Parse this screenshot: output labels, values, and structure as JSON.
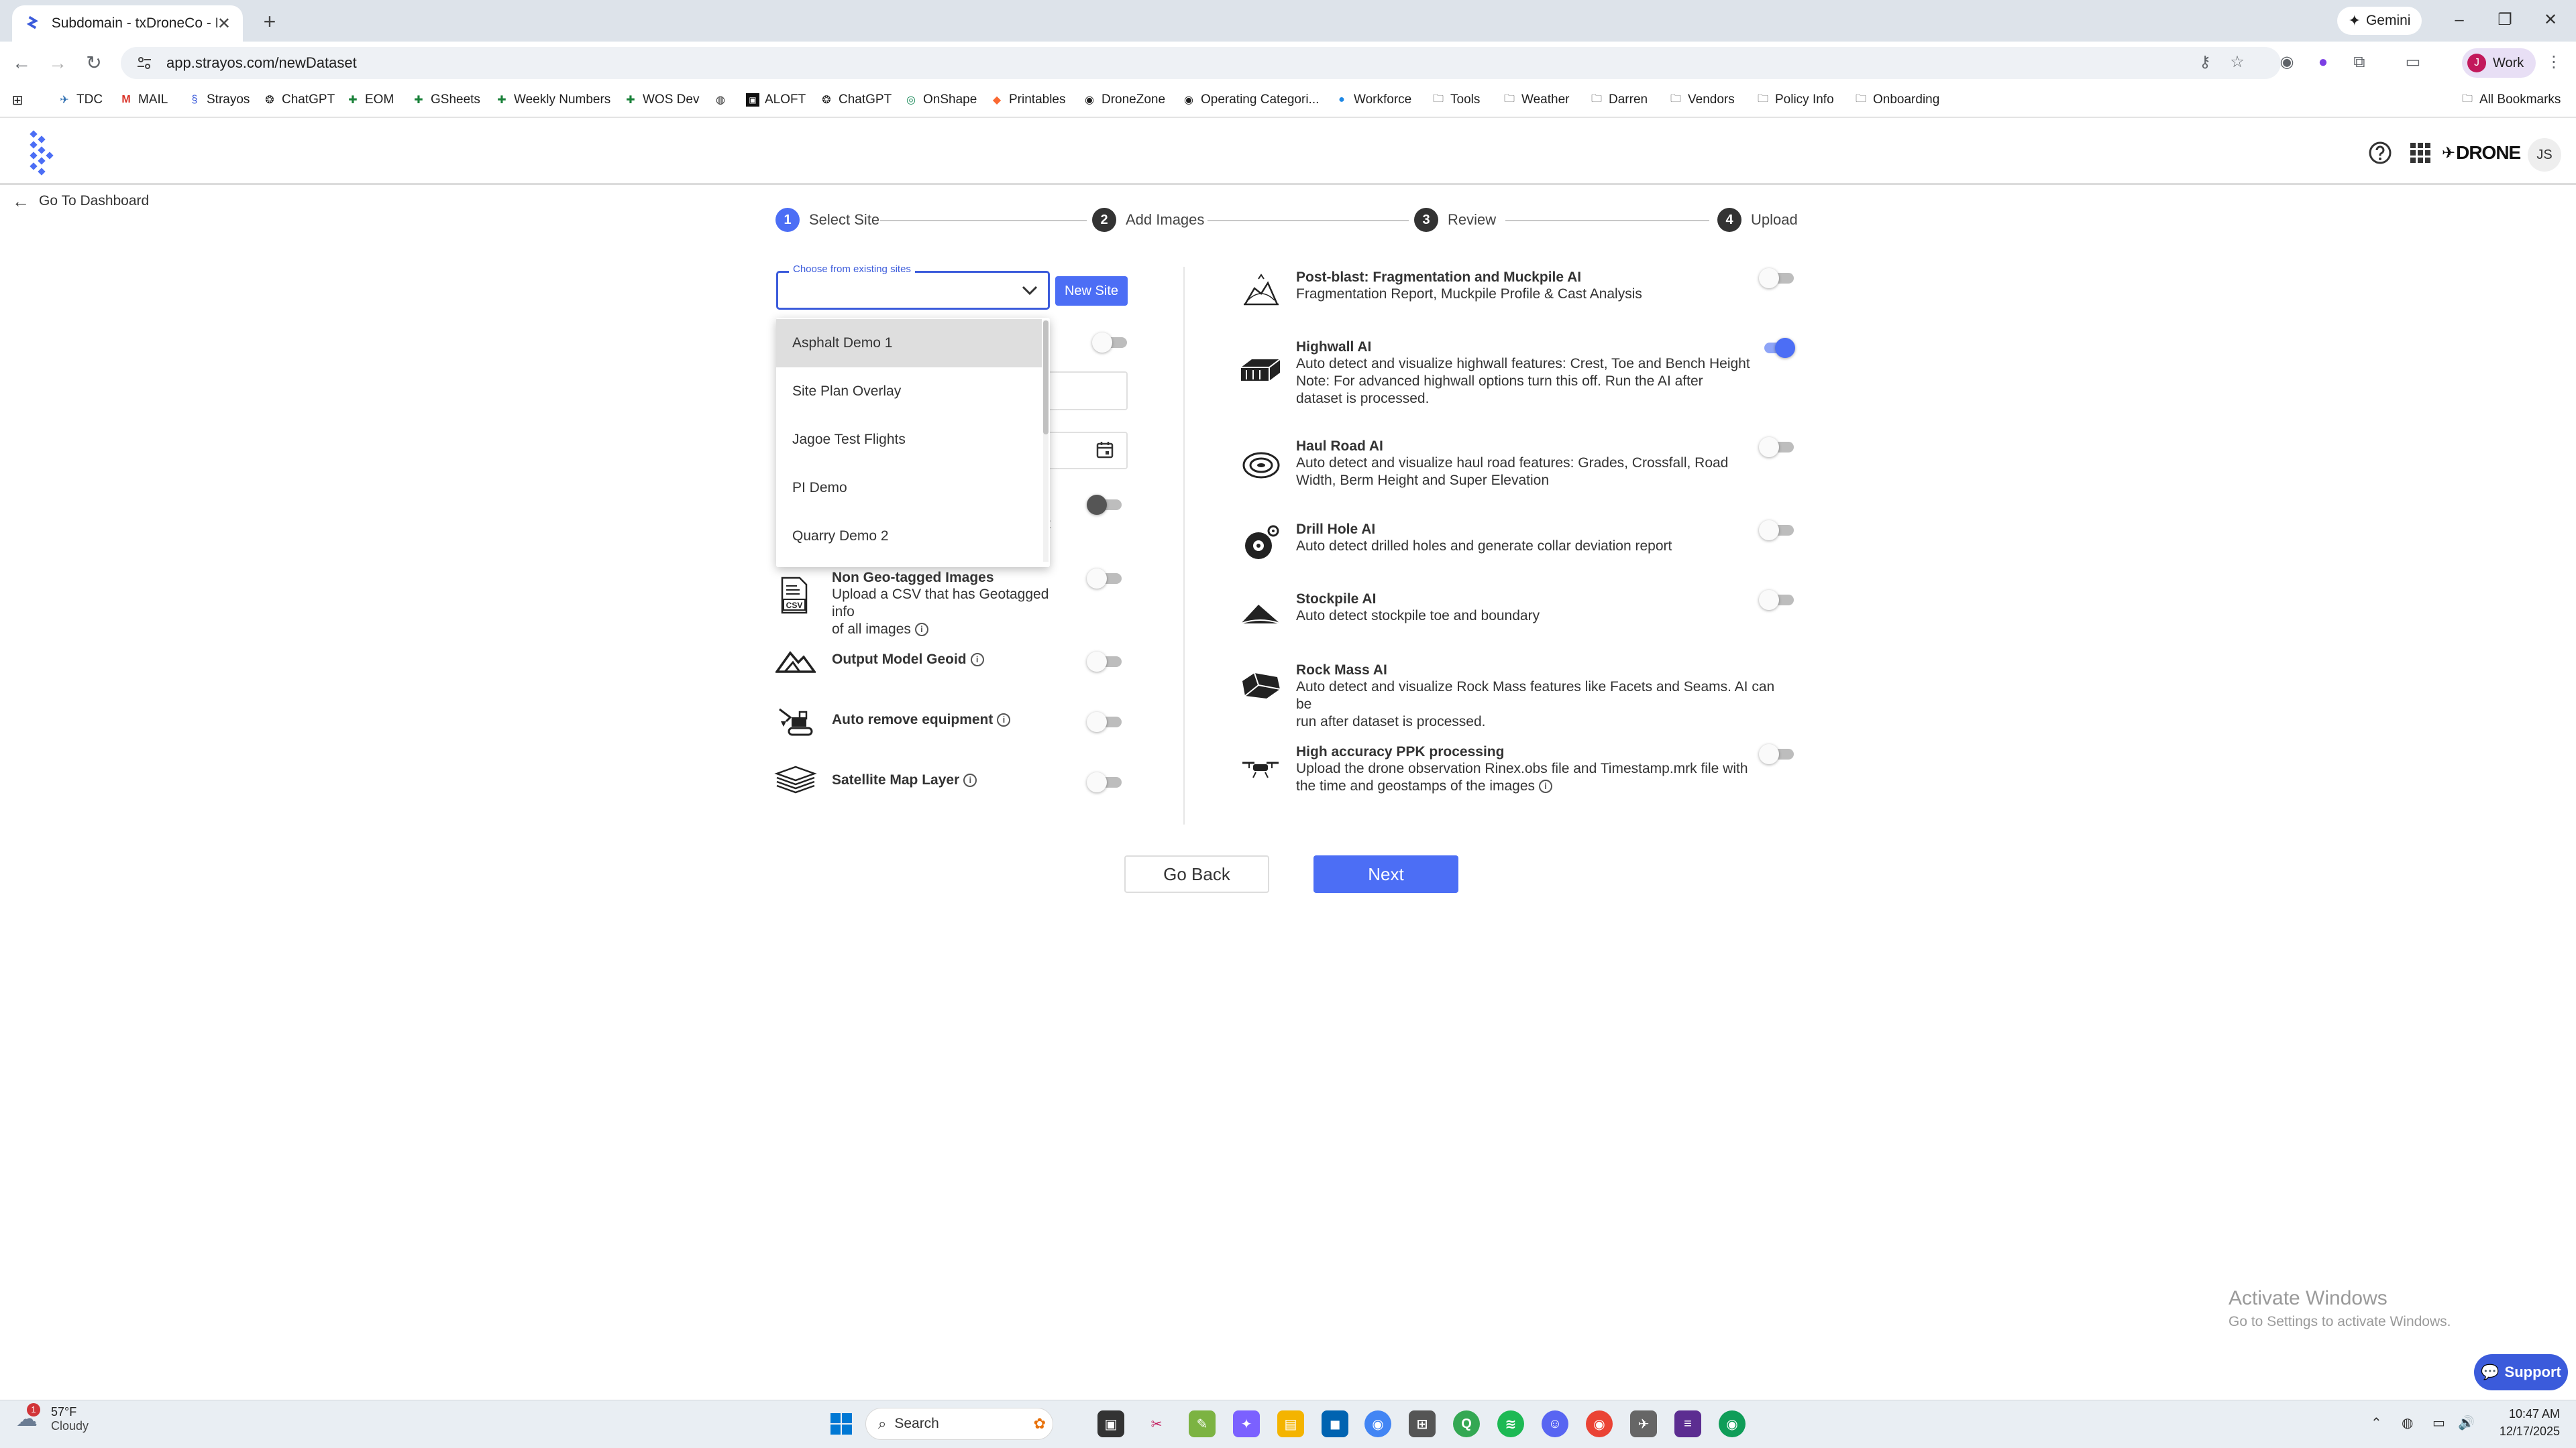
{
  "browser": {
    "tab_title": "Subdomain - txDroneCo - Dem",
    "url": "app.strayos.com/newDataset",
    "gemini_label": "Gemini",
    "profile_initial": "J",
    "profile_name": "Work",
    "all_bookmarks": "All Bookmarks",
    "bookmarks": [
      "TDC",
      "MAIL",
      "Strayos",
      "ChatGPT",
      "EOM",
      "GSheets",
      "Weekly Numbers",
      "WOS Dev",
      "",
      "ALOFT",
      "ChatGPT",
      "OnShape",
      "Printables",
      "DroneZone",
      "Operating Categori...",
      "Workforce",
      "Tools",
      "Weather",
      "Darren",
      "Vendors",
      "Policy Info",
      "Onboarding"
    ]
  },
  "header": {
    "drone_logo": "DRONE",
    "avatar_initials": "JS",
    "back_link": "Go To Dashboard"
  },
  "stepper": [
    {
      "num": "1",
      "label": "Select Site"
    },
    {
      "num": "2",
      "label": "Add Images"
    },
    {
      "num": "3",
      "label": "Review"
    },
    {
      "num": "4",
      "label": "Upload"
    }
  ],
  "site_select": {
    "label": "Choose from existing sites",
    "new_site": "New Site",
    "options": [
      "Asphalt Demo 1",
      "Site Plan Overlay",
      "Jagoe Test Flights",
      "PI Demo",
      "Quarry Demo 2"
    ],
    "partial_visible": "t"
  },
  "left_options": [
    {
      "title": "Non Geo-tagged Images",
      "desc1": "Upload a CSV that has Geotagged info",
      "desc2": "of all images"
    },
    {
      "title": "Output Model Geoid"
    },
    {
      "title": "Auto remove equipment"
    },
    {
      "title": "Satellite Map Layer"
    }
  ],
  "ai_options": [
    {
      "title": "Post-blast: Fragmentation and Muckpile AI",
      "desc": [
        "Fragmentation Report, Muckpile Profile & Cast Analysis"
      ],
      "on": false
    },
    {
      "title": "Highwall AI",
      "desc": [
        "Auto detect and visualize highwall features: Crest, Toe and Bench Height",
        "Note: For advanced highwall options turn this off. Run the AI after",
        "dataset is processed."
      ],
      "on": true
    },
    {
      "title": "Haul Road AI",
      "desc": [
        "Auto detect and visualize haul road features: Grades, Crossfall, Road",
        "Width, Berm Height and Super Elevation"
      ],
      "on": false
    },
    {
      "title": "Drill Hole AI",
      "desc": [
        "Auto detect drilled holes and generate collar deviation report"
      ],
      "on": false
    },
    {
      "title": "Stockpile AI",
      "desc": [
        "Auto detect stockpile toe and boundary"
      ],
      "on": false
    },
    {
      "title": "Rock Mass AI",
      "desc": [
        "Auto detect and visualize Rock Mass features like Facets and Seams. AI can be",
        "run after dataset is processed."
      ],
      "on": null
    },
    {
      "title": "High accuracy PPK processing",
      "desc": [
        "Upload the drone observation Rinex.obs file and Timestamp.mrk file with",
        "the time and geostamps of the images"
      ],
      "on": false
    }
  ],
  "buttons": {
    "go_back": "Go Back",
    "next": "Next",
    "support": "Support"
  },
  "watermark": {
    "line1": "Activate Windows",
    "line2": "Go to Settings to activate Windows."
  },
  "taskbar": {
    "temp": "57°F",
    "condition": "Cloudy",
    "weather_badge": "1",
    "search": "Search",
    "time": "10:47 AM",
    "date": "12/17/2025"
  },
  "colors": {
    "accent": "#4c6ef5",
    "accent_dark": "#3b5bdb"
  }
}
